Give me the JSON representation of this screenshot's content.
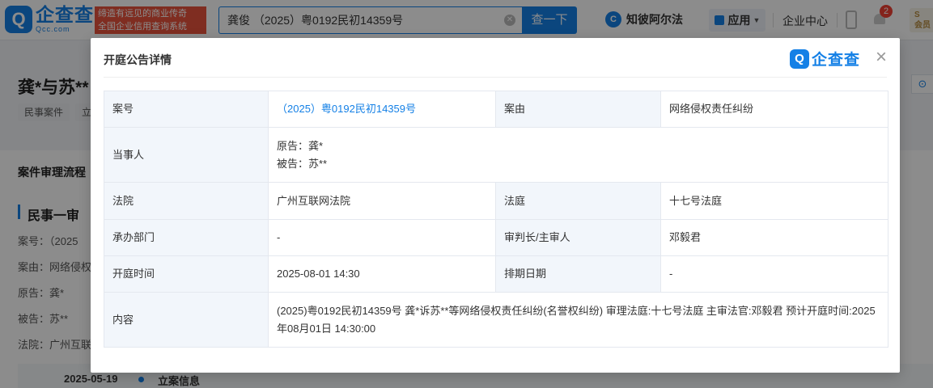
{
  "header": {
    "logo_mark": "Q",
    "logo_cn": "企查查",
    "logo_en": "Qcc.com",
    "slogan_line1": "缔造有远见的商业传奇",
    "slogan_line2": "全国企业信用查询系统",
    "search_value": "龚俊 （2025）粤0192民初14359号",
    "search_button": "查一下",
    "nav_law_icon": "C",
    "nav_law": "知彼阿尔法",
    "nav_app": "应用",
    "nav_center": "企业中心",
    "notification_count": "2",
    "vip_line1": "S",
    "vip_line2": "会员"
  },
  "background": {
    "case_title": "龚*与苏**",
    "tags": [
      "民事案件",
      "立"
    ],
    "section_title": "案件审理流程",
    "sub_title": "民事一审",
    "lines": [
      "案号：（2025",
      "案由：网络侵权",
      "原告：龚*",
      "被告：苏**",
      "法院：广州互联"
    ],
    "timeline_date": "2025-05-19",
    "timeline_event": "立案信息"
  },
  "modal": {
    "title": "开庭公告详情",
    "logo_mark": "Q",
    "logo_text": "企查查",
    "close_symbol": "×",
    "rows": {
      "case_no_label": "案号",
      "case_no_value": "（2025）粤0192民初14359号",
      "cause_label": "案由",
      "cause_value": "网络侵权责任纠纷",
      "parties_label": "当事人",
      "plaintiff": "原告：龚*",
      "defendant": "被告：苏**",
      "court_label": "法院",
      "court_value": "广州互联网法院",
      "courtroom_label": "法庭",
      "courtroom_value": "十七号法庭",
      "dept_label": "承办部门",
      "dept_value": "-",
      "judge_label": "审判长/主审人",
      "judge_value": "邓毅君",
      "hearing_time_label": "开庭时间",
      "hearing_time_value": "2025-08-01 14:30",
      "schedule_label": "排期日期",
      "schedule_value": "-",
      "content_label": "内容",
      "content_value": "(2025)粤0192民初14359号 龚*诉苏**等网络侵权责任纠纷(名誉权纠纷) 审理法庭:十七号法庭 主审法官:邓毅君 预计开庭时间:2025年08月01日 14:30:00"
    }
  },
  "colors": {
    "brand_blue": "#1480e6",
    "slogan_red": "#e7533c",
    "label_bg": "#f2f6fb",
    "badge_red": "#f04134"
  }
}
